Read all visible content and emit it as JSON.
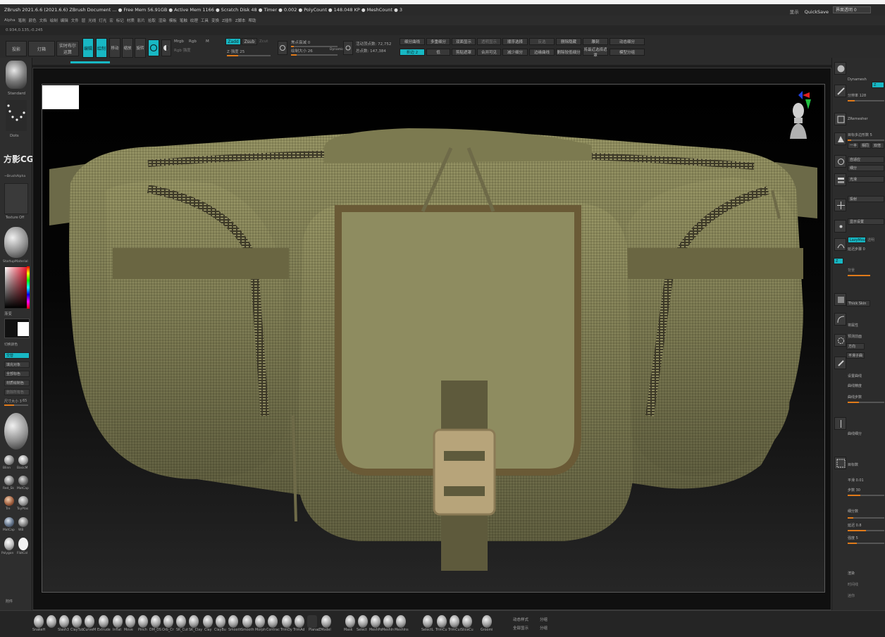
{
  "window": {
    "title": "ZBrush 2021.6.6 (2021.6.6)  ZBrush Document  ... ● Free Mem 56.91GB ● Active Mem 1166 ● Scratch Disk 48 ● Timer ● 0.002 ● PolyCount ● 148.048 KP ● MeshCount ● 3",
    "quicksave_label": "QuickSave",
    "ui_label": "显示",
    "transparency_field": "界面透明 0"
  },
  "menu": {
    "items": [
      "Alpha",
      "笔刷",
      "颜色",
      "文档",
      "绘制",
      "编辑",
      "文件",
      "层",
      "光线",
      "灯光",
      "宏",
      "标记",
      "材质",
      "影片",
      "拾取",
      "渲染",
      "模板",
      "笔触",
      "纹理",
      "工具",
      "变换",
      "Z插件",
      "Z脚本",
      "帮助"
    ]
  },
  "coords": "0.934,0.135,-0.245",
  "top_toolbar": {
    "projection_master": "投影",
    "lightbox": "灯箱",
    "live_boolean": "实时布尔 运算",
    "edit": "编辑",
    "draw": "绘制",
    "move": "移动",
    "scale": "缩放",
    "rotate": "旋转",
    "mrgb": "Mrgb",
    "rgb": "Rgb",
    "m": "M",
    "rgb_intensity": "Rgb 强度",
    "zadd": "Zadd",
    "zsub": "Zsub",
    "zcut": "Zcut",
    "z_intensity": "Z 强度 25",
    "focal_shift": "焦点衰减 0",
    "draw_size": "绘制大小 26",
    "dynamic": "Dynamic",
    "active_points": "活动顶点数: 72,752",
    "total_points": "总点数: 147,384",
    "shelf_buttons": [
      "细分曲线",
      "折边 2",
      "多重细分",
      "低",
      "双面显示",
      "剪贴遮罩",
      "透明显示",
      "合并可见",
      "顺序选择",
      "减少细分",
      "反选",
      "边缘曲线",
      "删除隐藏",
      "删除较低细分",
      "雕刻",
      "将最近选择遮罩",
      "动态细分",
      "模型分组"
    ]
  },
  "left_shelf": {
    "brush_label": "Standard",
    "stroke_label": "Dots",
    "logo_text": "方影CG",
    "alpha_label": "~BrushAlpha",
    "texture_label": "Texture Off",
    "material_label": "StartupMaterial",
    "gradient_label": "渐变",
    "swatch_label": "切换颜色",
    "buttons": [
      "交替",
      "填充对象",
      "全部标色",
      "材质绘制色",
      "删除所有色"
    ],
    "brush_size_label": "尺寸大小 3",
    "brush_size_value": "65",
    "material_names": [
      "Blinn",
      "BasicM",
      "Red_Sk",
      "MatCap",
      "Tre",
      "ToyPlas",
      "MatCap",
      "WB",
      "Polygon",
      "FlatCol"
    ],
    "bottom_label": "附件"
  },
  "right_panel": {
    "dynamesh": "Dynamesh",
    "resolution": "分辨率 128",
    "zremesher": "ZRemesher",
    "target_polys": "目标多边形数 5",
    "half": "一半",
    "same": "相同",
    "double": "双倍",
    "adaptive": "自适应",
    "subdivide": "细分",
    "smooth": "光滑",
    "projection": "投射",
    "lazymouse": "LazyMouse",
    "lazystep": "延迟步骤 0",
    "active_btn": "Z",
    "thick_skin": "Thick Skin",
    "labels": [
      "显示设置",
      "透明",
      "背景",
      "将属性",
      "预测前面",
      "方向",
      "平滑子曲",
      "设置曲线",
      "曲线精度",
      "曲线步数",
      "曲线细分",
      "目标数",
      "细分数"
    ],
    "sliders": [
      "平滑 0.01",
      "步数 30",
      "延迟 0.8",
      "强度 5"
    ],
    "footer": [
      "渲染",
      "时间线",
      "迷你"
    ]
  },
  "bottom_shelf": {
    "brushes": [
      "SnakeH",
      "Slash3",
      "ClayTub",
      "CurveM",
      "Extrude",
      "Inflat",
      "Move",
      "Pinch",
      "DM_DS",
      "Orb_Cr",
      "SK_Cut",
      "SK_Clay",
      "Clay",
      "ClayBu",
      "Smooth",
      "Smooth",
      "Morph",
      "Contrac",
      "TrimDy",
      "TrimAd",
      "Planar",
      "ZModel",
      "Mask",
      "Select",
      "MeshPo",
      "MeshIn",
      "MeshIns",
      "SelectL",
      "TrimCu",
      "TrimCui",
      "SliceCu",
      "Groomi"
    ],
    "right_labels": [
      "动态样式",
      "全部显示",
      "分组",
      "分组"
    ]
  }
}
